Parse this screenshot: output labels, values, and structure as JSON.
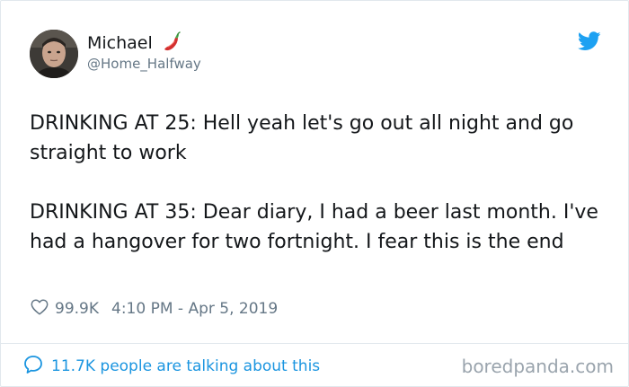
{
  "author": {
    "display_name": "Michael",
    "handle": "@Home_Halfway",
    "name_emoji": "hot-pepper-icon",
    "avatar": "avatar-photo"
  },
  "tweet": {
    "paragraphs": [
      "DRINKING AT 25: Hell yeah let's go out all night and go straight to work",
      "DRINKING AT 35: Dear diary, I had a beer last month. I've had a hangover for two fortnight. I fear this is the end"
    ],
    "like_count": "99.9K",
    "timestamp": "4:10 PM - Apr 5, 2019"
  },
  "footer": {
    "discussion_label": "11.7K people are talking about this",
    "watermark": "boredpanda.com"
  },
  "icons": {
    "platform": "twitter-bird-icon",
    "like": "heart-outline-icon",
    "discussion": "speech-bubble-icon"
  },
  "colors": {
    "twitter_blue": "#1da1f2",
    "link_blue": "#1b95e0",
    "text_primary": "#14171a",
    "text_secondary": "#657786",
    "border": "#e1e8ed",
    "pepper_red": "#d32f2f"
  }
}
